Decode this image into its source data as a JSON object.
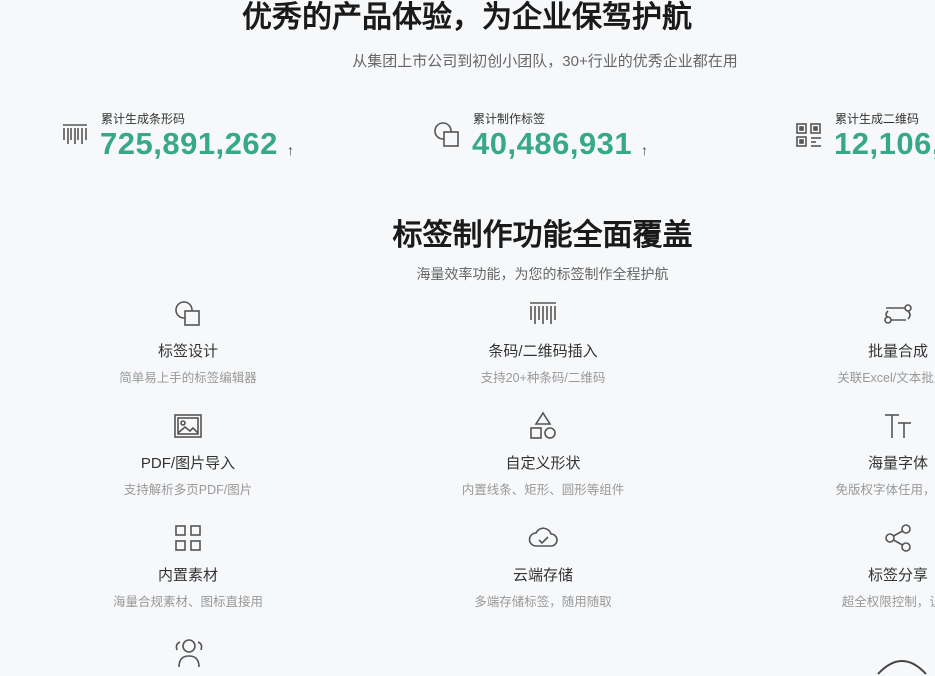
{
  "hero": {
    "title": "优秀的产品体验，为企业保驾护航",
    "subtitle": "从集团上市公司到初创小团队，30+行业的优秀企业都在用"
  },
  "stats": [
    {
      "label": "累计生成条形码",
      "value": "725,891,262",
      "arrow": "↑",
      "icon": "barcode-icon"
    },
    {
      "label": "累计制作标签",
      "value": "40,486,931",
      "arrow": "↑",
      "icon": "label-shapes-icon"
    },
    {
      "label": "累计生成二维码",
      "value": "12,106,",
      "icon": "qrcode-icon"
    }
  ],
  "features_section": {
    "title": "标签制作功能全面覆盖",
    "subtitle": "海量效率功能，为您的标签制作全程护航"
  },
  "features": [
    {
      "name": "标签设计",
      "desc": "简单易上手的标签编辑器",
      "icon": "label-design-icon"
    },
    {
      "name": "条码/二维码插入",
      "desc": "支持20+种条码/二维码",
      "icon": "barcode-icon"
    },
    {
      "name": "批量合成",
      "desc": "关联Excel/文本批量合",
      "icon": "batch-merge-icon"
    },
    {
      "name": "PDF/图片导入",
      "desc": "支持解析多页PDF/图片",
      "icon": "image-icon"
    },
    {
      "name": "自定义形状",
      "desc": "内置线条、矩形、圆形等组件",
      "icon": "shapes-icon"
    },
    {
      "name": "海量字体",
      "desc": "免版权字体任用，支持",
      "icon": "font-icon"
    },
    {
      "name": "内置素材",
      "desc": "海量合规素材、图标直接用",
      "icon": "grid-icon"
    },
    {
      "name": "云端存储",
      "desc": "多端存储标签，随用随取",
      "icon": "cloud-icon"
    },
    {
      "name": "标签分享",
      "desc": "超全权限控制，让交",
      "icon": "share-icon"
    }
  ],
  "colors": {
    "accent": "#37a98a",
    "background": "#f7f8fa"
  }
}
